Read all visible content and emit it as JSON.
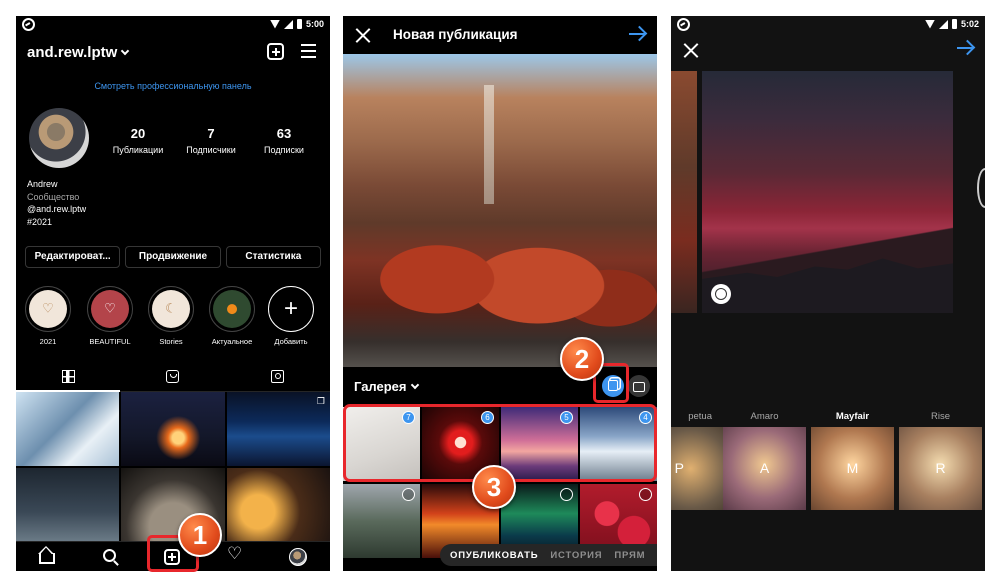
{
  "panel1": {
    "status": {
      "time": "5:00"
    },
    "username": "and.rew.lptw",
    "pro_link": "Смотреть профессиональную панель",
    "stats": [
      {
        "num": "20",
        "label": "Публикации"
      },
      {
        "num": "7",
        "label": "Подписчики"
      },
      {
        "num": "63",
        "label": "Подписки"
      }
    ],
    "bio": {
      "name": "Andrew",
      "category": "Сообщество",
      "handle": "@and.rew.lptw",
      "tag": "#2021"
    },
    "buttons": [
      "Редактироват...",
      "Продвижение",
      "Статистика"
    ],
    "highlights": [
      {
        "label": "2021",
        "icon": "heart-outline-icon"
      },
      {
        "label": "BEAUTIFUL",
        "icon": "heart-outline-icon"
      },
      {
        "label": "Stories",
        "icon": "moon-icon"
      },
      {
        "label": "Актуальное",
        "icon": "fruit-icon"
      },
      {
        "label": "Добавить",
        "icon": "plus-icon"
      }
    ],
    "tabs": [
      "grid-icon",
      "reels-icon",
      "tagged-icon"
    ],
    "step_badge": "1"
  },
  "panel2": {
    "title": "Новая публикация",
    "gallery_label": "Галерея",
    "selected_badges": [
      "7",
      "6",
      "5",
      "4"
    ],
    "mode_tabs": [
      "ОПУБЛИКОВАТЬ",
      "ИСТОРИЯ",
      "ПРЯМ"
    ],
    "step_badges": [
      "2",
      "3"
    ]
  },
  "panel3": {
    "status": {
      "time": "5:02"
    },
    "filters": [
      {
        "name": "petua",
        "letter": "P"
      },
      {
        "name": "Amaro",
        "letter": "A"
      },
      {
        "name": "Mayfair",
        "letter": "M",
        "selected": true
      },
      {
        "name": "Rise",
        "letter": "R"
      }
    ]
  },
  "colors": {
    "accent": "#3d95ef",
    "highlight_red": "#e8272c",
    "step_badge": "#e14b1c"
  }
}
